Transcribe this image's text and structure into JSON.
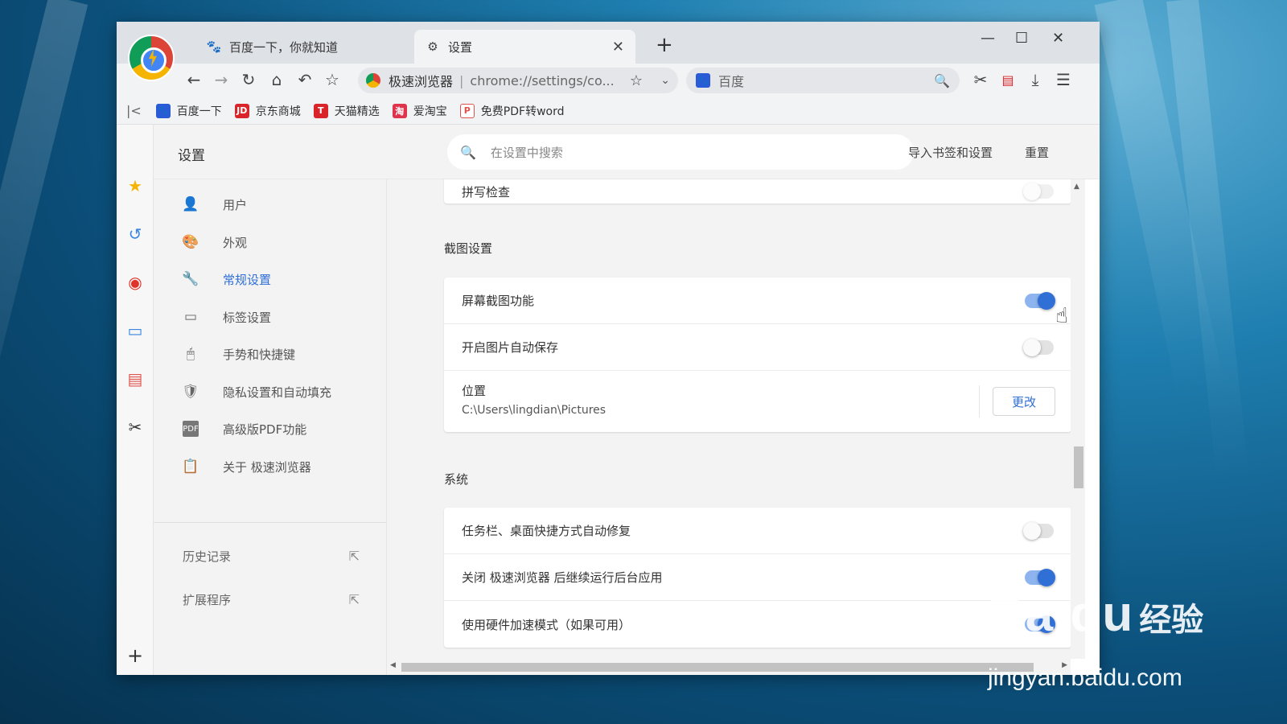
{
  "tabs": [
    {
      "label": "百度一下，你就知道",
      "icon": "baidu-paw-icon"
    },
    {
      "label": "设置",
      "icon": "gear-icon",
      "active": true
    }
  ],
  "toolbar": {
    "browser_name": "极速浏览器",
    "url": "chrome://settings/co...",
    "search_engine": "百度"
  },
  "bookmarks": [
    {
      "label": "百度一下",
      "color": "#2a5bd7",
      "glyph": "🐾"
    },
    {
      "label": "京东商城",
      "color": "#d9252a",
      "glyph": "JD"
    },
    {
      "label": "天猫精选",
      "color": "#d9252a",
      "glyph": "T"
    },
    {
      "label": "爱淘宝",
      "color": "#e0344d",
      "glyph": "淘"
    },
    {
      "label": "免费PDF转word",
      "color": "#e0524d",
      "glyph": "P"
    }
  ],
  "settings": {
    "title": "设置",
    "search_placeholder": "在设置中搜索",
    "import_link": "导入书签和设置",
    "reset_link": "重置"
  },
  "nav": {
    "items": [
      {
        "label": "用户",
        "icon": "user-icon"
      },
      {
        "label": "外观",
        "icon": "palette-icon"
      },
      {
        "label": "常规设置",
        "icon": "wrench-icon",
        "active": true
      },
      {
        "label": "标签设置",
        "icon": "tab-icon"
      },
      {
        "label": "手势和快捷键",
        "icon": "mouse-icon"
      },
      {
        "label": "隐私设置和自动填充",
        "icon": "shield-icon"
      },
      {
        "label": "高级版PDF功能",
        "icon": "pdf-icon"
      },
      {
        "label": "关于 极速浏览器",
        "icon": "clipboard-icon"
      }
    ],
    "links": [
      {
        "label": "历史记录"
      },
      {
        "label": "扩展程序"
      }
    ]
  },
  "content": {
    "partial_row": "拼写检查",
    "screenshot_section": {
      "title": "截图设置",
      "rows": [
        {
          "label": "屏幕截图功能",
          "on": true
        },
        {
          "label": "开启图片自动保存",
          "on": false
        }
      ],
      "location_label": "位置",
      "location_path": "C:\\Users\\lingdian\\Pictures",
      "change_button": "更改"
    },
    "system_section": {
      "title": "系统",
      "rows": [
        {
          "label": "任务栏、桌面快捷方式自动修复",
          "on": false
        },
        {
          "label": "关闭 极速浏览器 后继续运行后台应用",
          "on": true
        },
        {
          "label": "使用硬件加速模式（如果可用）",
          "on": true
        }
      ]
    }
  },
  "watermark": {
    "brand": "Baidu",
    "brand_cn": "经验",
    "url": "jingyan.baidu.com"
  }
}
